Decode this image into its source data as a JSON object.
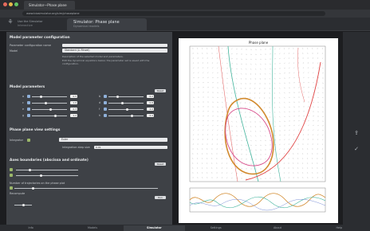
{
  "browser": {
    "tab_title": "Simulator—Phase plane",
    "url": "www.biosimulator.org/sim/phaseplane"
  },
  "app": {
    "name_line1": "Use the Simulator",
    "name_line2": "Interactive",
    "current_tab_title": "Simulator: Phase plane",
    "current_tab_sub": "Dynamical models"
  },
  "left": {
    "model_section": "Model parameter configuration",
    "config_label": "Parameter configuration name",
    "model_label": "Model",
    "model_select": "Standard (Li-Rinzel)",
    "model_note_1": "Description of the selected model and parameters.",
    "model_note_2": "Edit the dynamical equations below; the parameter set is saved with the configuration.",
    "params_section": "Model parameters",
    "params_reset": "Reset",
    "param_names": [
      "a",
      "b",
      "c",
      "d",
      "e",
      "f",
      "g",
      "h"
    ],
    "param_values": [
      "0.5",
      "0.2",
      "1.0",
      "0.8",
      "0.3",
      "2.0",
      "1.2",
      "0.4"
    ],
    "phase_section": "Phase plane view settings",
    "integrator_label": "Integrator",
    "integrator_value": "Euler",
    "step_label": "Integration step size",
    "step_value": "0.01",
    "bounds_section": "Axes boundaries (abscissa and ordinate)",
    "bounds_reset": "Reset",
    "traj_label": "Number of trajectories on the phase plot",
    "traj_value": "3",
    "traj_btn": "Update",
    "recompute_label": "Recompute",
    "recompute_btn": "Run"
  },
  "plot": {
    "title": "Phase plane"
  },
  "right": {
    "icons": [
      "share-icon",
      "check-icon"
    ]
  },
  "bottom": {
    "tabs": [
      "Info",
      "Models",
      "Simulator",
      "Settings",
      "About",
      "Help"
    ],
    "active": "Simulator"
  }
}
